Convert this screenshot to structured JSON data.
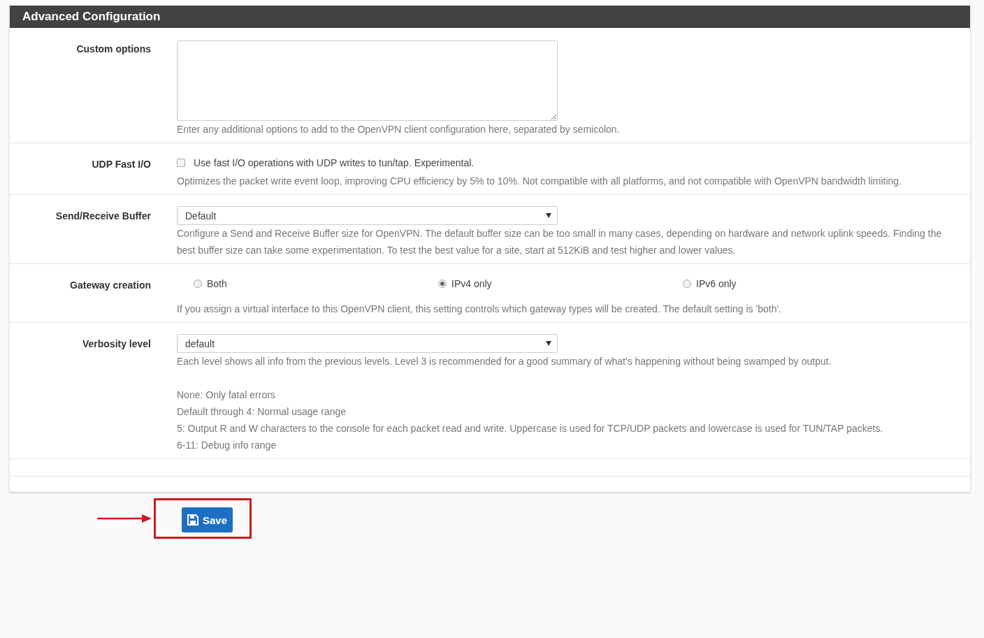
{
  "panel": {
    "title": "Advanced Configuration"
  },
  "rows": [
    {
      "kind": "textarea",
      "label": "Custom options",
      "help": [
        "Enter any additional options to add to the OpenVPN client configuration here, separated by semicolon."
      ]
    },
    {
      "kind": "checkbox",
      "label": "UDP Fast I/O",
      "option": "Use fast I/O operations with UDP writes to tun/tap. Experimental.",
      "checked": false,
      "help": [
        "Optimizes the packet write event loop, improving CPU efficiency by 5% to 10%. Not compatible with all platforms, and not compatible with OpenVPN bandwidth limiting."
      ]
    },
    {
      "kind": "select",
      "label": "Send/Receive Buffer",
      "value": "Default",
      "help": [
        "Configure a Send and Receive Buffer size for OpenVPN. The default buffer size can be too small in many cases, depending on hardware and network uplink speeds. Finding the best buffer size can take some experimentation. To test the best value for a site, start at 512KiB and test higher and lower values."
      ]
    },
    {
      "kind": "radio",
      "label": "Gateway creation",
      "options": [
        {
          "label": "Both",
          "selected": false
        },
        {
          "label": "IPv4 only",
          "selected": true
        },
        {
          "label": "IPv6 only",
          "selected": false
        }
      ],
      "help": [
        "If you assign a virtual interface to this OpenVPN client, this setting controls which gateway types will be created. The default setting is 'both'."
      ]
    },
    {
      "kind": "select",
      "label": "Verbosity level",
      "value": "default",
      "help": [
        "Each level shows all info from the previous levels. Level 3 is recommended for a good summary of what's happening without being swamped by output."
      ],
      "notes": [
        "None: Only fatal errors",
        "Default through 4: Normal usage range",
        "5: Output R and W characters to the console for each packet read and write. Uppercase is used for TCP/UDP packets and lowercase is used for TUN/TAP packets.",
        "6-11: Debug info range"
      ]
    }
  ],
  "save": {
    "label": "Save"
  }
}
